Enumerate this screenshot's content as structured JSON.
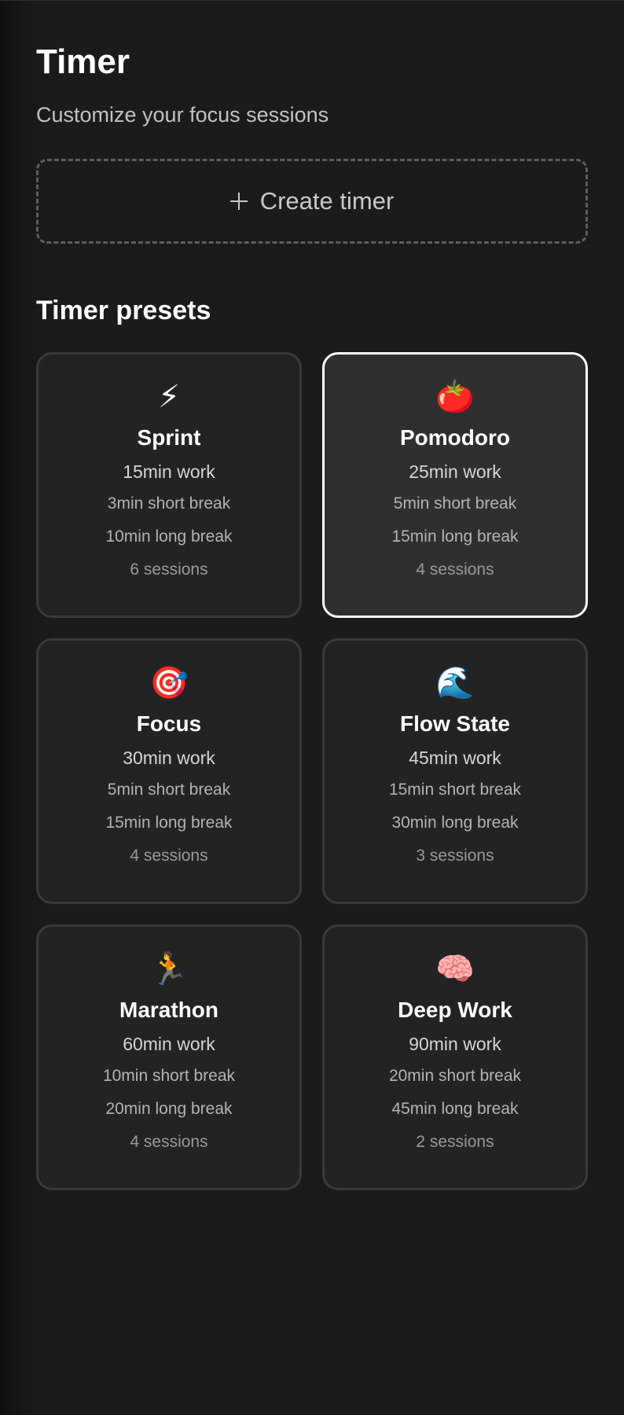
{
  "header": {
    "title": "Timer",
    "subtitle": "Customize your focus sessions"
  },
  "create_button": {
    "label": "Create timer",
    "icon": "plus-icon"
  },
  "presets_section": {
    "title": "Timer presets",
    "selected": "Pomodoro",
    "presets": [
      {
        "icon": "⚡",
        "icon_name": "lightning-icon",
        "name": "Sprint",
        "work": "15min work",
        "short_break": "3min short break",
        "long_break": "10min long break",
        "sessions": "6 sessions"
      },
      {
        "icon": "🍅",
        "icon_name": "tomato-icon",
        "name": "Pomodoro",
        "work": "25min work",
        "short_break": "5min short break",
        "long_break": "15min long break",
        "sessions": "4 sessions"
      },
      {
        "icon": "🎯",
        "icon_name": "target-icon",
        "name": "Focus",
        "work": "30min work",
        "short_break": "5min short break",
        "long_break": "15min long break",
        "sessions": "4 sessions"
      },
      {
        "icon": "🌊",
        "icon_name": "wave-icon",
        "name": "Flow State",
        "work": "45min work",
        "short_break": "15min short break",
        "long_break": "30min long break",
        "sessions": "3 sessions"
      },
      {
        "icon": "🏃",
        "icon_name": "runner-icon",
        "name": "Marathon",
        "work": "60min work",
        "short_break": "10min short break",
        "long_break": "20min long break",
        "sessions": "4 sessions"
      },
      {
        "icon": "🧠",
        "icon_name": "brain-icon",
        "name": "Deep Work",
        "work": "90min work",
        "short_break": "20min short break",
        "long_break": "45min long break",
        "sessions": "2 sessions"
      }
    ]
  },
  "colors": {
    "background": "#1b1b1b",
    "card_background": "#232323",
    "selected_card_background": "#2f2f2f",
    "card_border": "#3a3a3a",
    "selected_border": "#ffffff",
    "muted_text": "#b4b4b4"
  }
}
